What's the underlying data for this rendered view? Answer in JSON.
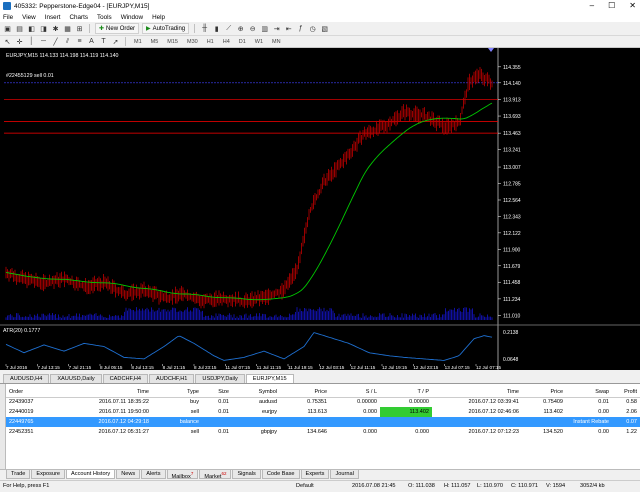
{
  "window": {
    "title": "405332: Pepperstone-Edge04 - [EURJPY,M15]",
    "min": "–",
    "max": "☐",
    "close": "✕"
  },
  "menu": [
    "File",
    "View",
    "Insert",
    "Charts",
    "Tools",
    "Window",
    "Help"
  ],
  "toolbar": {
    "new_order": "New Order",
    "auto_trading": "AutoTrading"
  },
  "timeframes": [
    "M1",
    "M5",
    "M15",
    "M30",
    "H1",
    "H4",
    "D1",
    "W1",
    "MN"
  ],
  "chart": {
    "header": "EURJPY,M15  114.133 114.198 114.119 114.140",
    "trade_label": "#22455129 sell 0.01",
    "indicator_header": "ATR(20) 0.1777",
    "price_labels": [
      "114.355",
      "114.140",
      "113.913",
      "113.693",
      "113.463",
      "113.241",
      "113.007",
      "112.785",
      "112.564",
      "112.343",
      "112.122",
      "111.900",
      "111.679",
      "111.458",
      "111.234",
      "111.010"
    ],
    "atr_labels": [
      "0.2138",
      "0.0648"
    ],
    "time_labels": [
      "7 Jul 2016",
      "7 Jul 13:15",
      "7 Jul 21:15",
      "8 Jul 05:15",
      "8 Jul 13:15",
      "8 Jul 21:15",
      "8 Jul 23:15",
      "11 Jul 07:15",
      "11 Jul 11:15",
      "11 Jul 19:15",
      "12 Jul 03:15",
      "12 Jul 11:15",
      "12 Jul 19:15",
      "12 Jul 23:15",
      "13 Jul 07:15",
      "12 Jul 07:15"
    ],
    "colors": {
      "candles": "#c00000",
      "ma": "#00c800",
      "volume": "#1010a0",
      "atr": "#1e6fd0",
      "hline_red": "#ff0000",
      "hline_blue": "#4040ff"
    }
  },
  "chart_tabs": [
    "AUDUSD,H4",
    "XAUUSD,Daily",
    "CADCHF,H4",
    "AUDCHF,H1",
    "USDJPY,Daily",
    "EURJPY,M15"
  ],
  "history": {
    "columns": [
      "Order",
      "Time",
      "Type",
      "Size",
      "Symbol",
      "Price",
      "S / L",
      "T / P",
      "Time",
      "Price",
      "Swap",
      "Profit"
    ],
    "rows": [
      [
        "22439037",
        "2016.07.11 18:35:22",
        "buy",
        "0.01",
        "audusd",
        "0.75351",
        "0.00000",
        "0.00000",
        "2016.07.12 03:39:41",
        "0.75409",
        "0.01",
        "0.58"
      ],
      [
        "22440019",
        "2016.07.11 19:50:00",
        "sell",
        "0.01",
        "eurjpy",
        "113.613",
        "0.000",
        "113.402",
        "2016.07.12 02:46:06",
        "113.402",
        "0.00",
        "2.06"
      ],
      [
        "22449765",
        "2016.07.12 04:29:18",
        "balance",
        "",
        "",
        "",
        "",
        "",
        "",
        "",
        "Instant Rebate",
        "0.07"
      ],
      [
        "22452351",
        "2016.07.12 05:31:27",
        "sell",
        "0.01",
        "gbpjpy",
        "134.646",
        "0.000",
        "0.000",
        "2016.07.12 07:12:23",
        "134.520",
        "0.00",
        "1.22"
      ]
    ]
  },
  "terminal_tabs": [
    "Trade",
    "Exposure",
    "Account History",
    "News",
    "Alerts",
    "Mailbox",
    "Market",
    "Signals",
    "Code Base",
    "Experts",
    "Journal"
  ],
  "terminal_badges": {
    "Mailbox": "7",
    "Market": "62"
  },
  "status": {
    "help": "For Help, press F1",
    "profile": "Default",
    "datetime": "2016.07.08 21:45",
    "open": "O: 111.038",
    "high": "H: 111.057",
    "low": "L: 110.970",
    "close": "C: 110.971",
    "volume": "V: 1594",
    "traffic": "3052/4 kb"
  }
}
